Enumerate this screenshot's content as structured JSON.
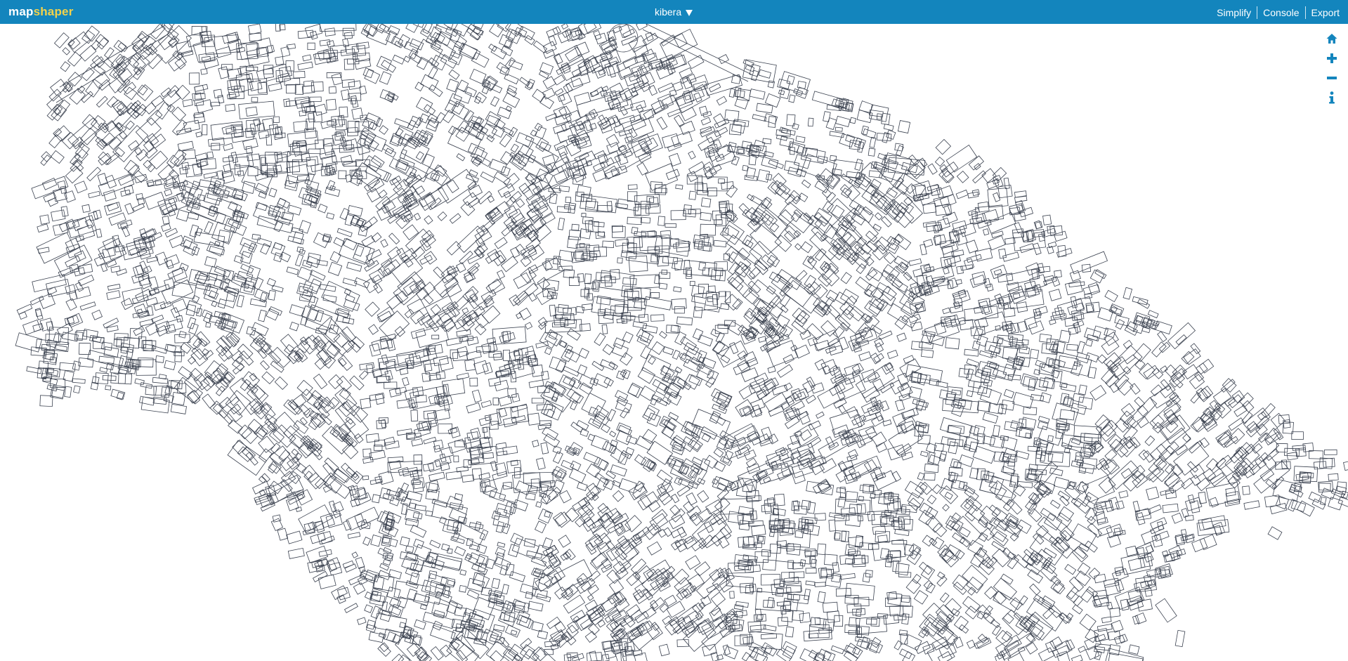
{
  "app": {
    "brand_left": "map",
    "brand_right": "shaper"
  },
  "header": {
    "layer_name": "kibera",
    "menu": {
      "simplify": "Simplify",
      "console": "Console",
      "export": "Export"
    }
  },
  "colors": {
    "header_bg": "#1385bd",
    "brand_accent": "#f3d24a",
    "shape_stroke": "#3b4250",
    "tool_icon": "#1385bd"
  },
  "map_tools": [
    {
      "name": "home-icon"
    },
    {
      "name": "zoom-in-icon"
    },
    {
      "name": "zoom-out-icon"
    },
    {
      "name": "info-icon"
    }
  ]
}
